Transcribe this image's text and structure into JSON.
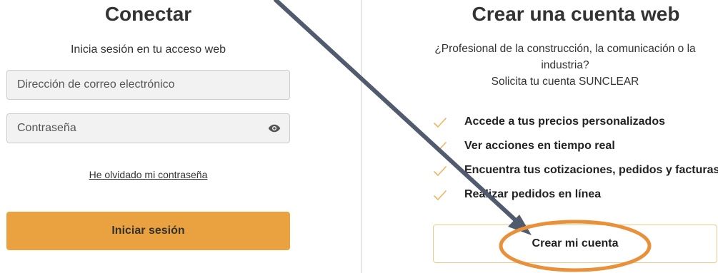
{
  "login": {
    "title": "Conectar",
    "subtitle": "Inicia sesión en tu acceso web",
    "email_placeholder": "Dirección de correo electrónico",
    "password_placeholder": "Contraseña",
    "forgot_password": "He olvidado mi contraseña",
    "submit_label": "Iniciar sesión",
    "icons": {
      "password_toggle": "eye-icon"
    }
  },
  "signup": {
    "title": "Crear una cuenta web",
    "intro_line1": "¿Profesional de la construcción, la comunicación o la industria?",
    "intro_line2": "Solicita tu cuenta SUNCLEAR",
    "benefits": [
      "Accede a tus precios personalizados",
      "Ver acciones en tiempo real",
      "Encuentra tus cotizaciones, pedidos y facturas",
      "Realizar pedidos en línea"
    ],
    "cta_label": "Crear mi cuenta",
    "icons": {
      "benefit_marker": "check-icon"
    }
  },
  "colors": {
    "accent": "#e9a23f",
    "check": "#f0b45f",
    "annotation_arrow": "#505b6e",
    "annotation_circle": "#e9913a",
    "text": "#333333",
    "field_background": "#f2f2f2"
  }
}
